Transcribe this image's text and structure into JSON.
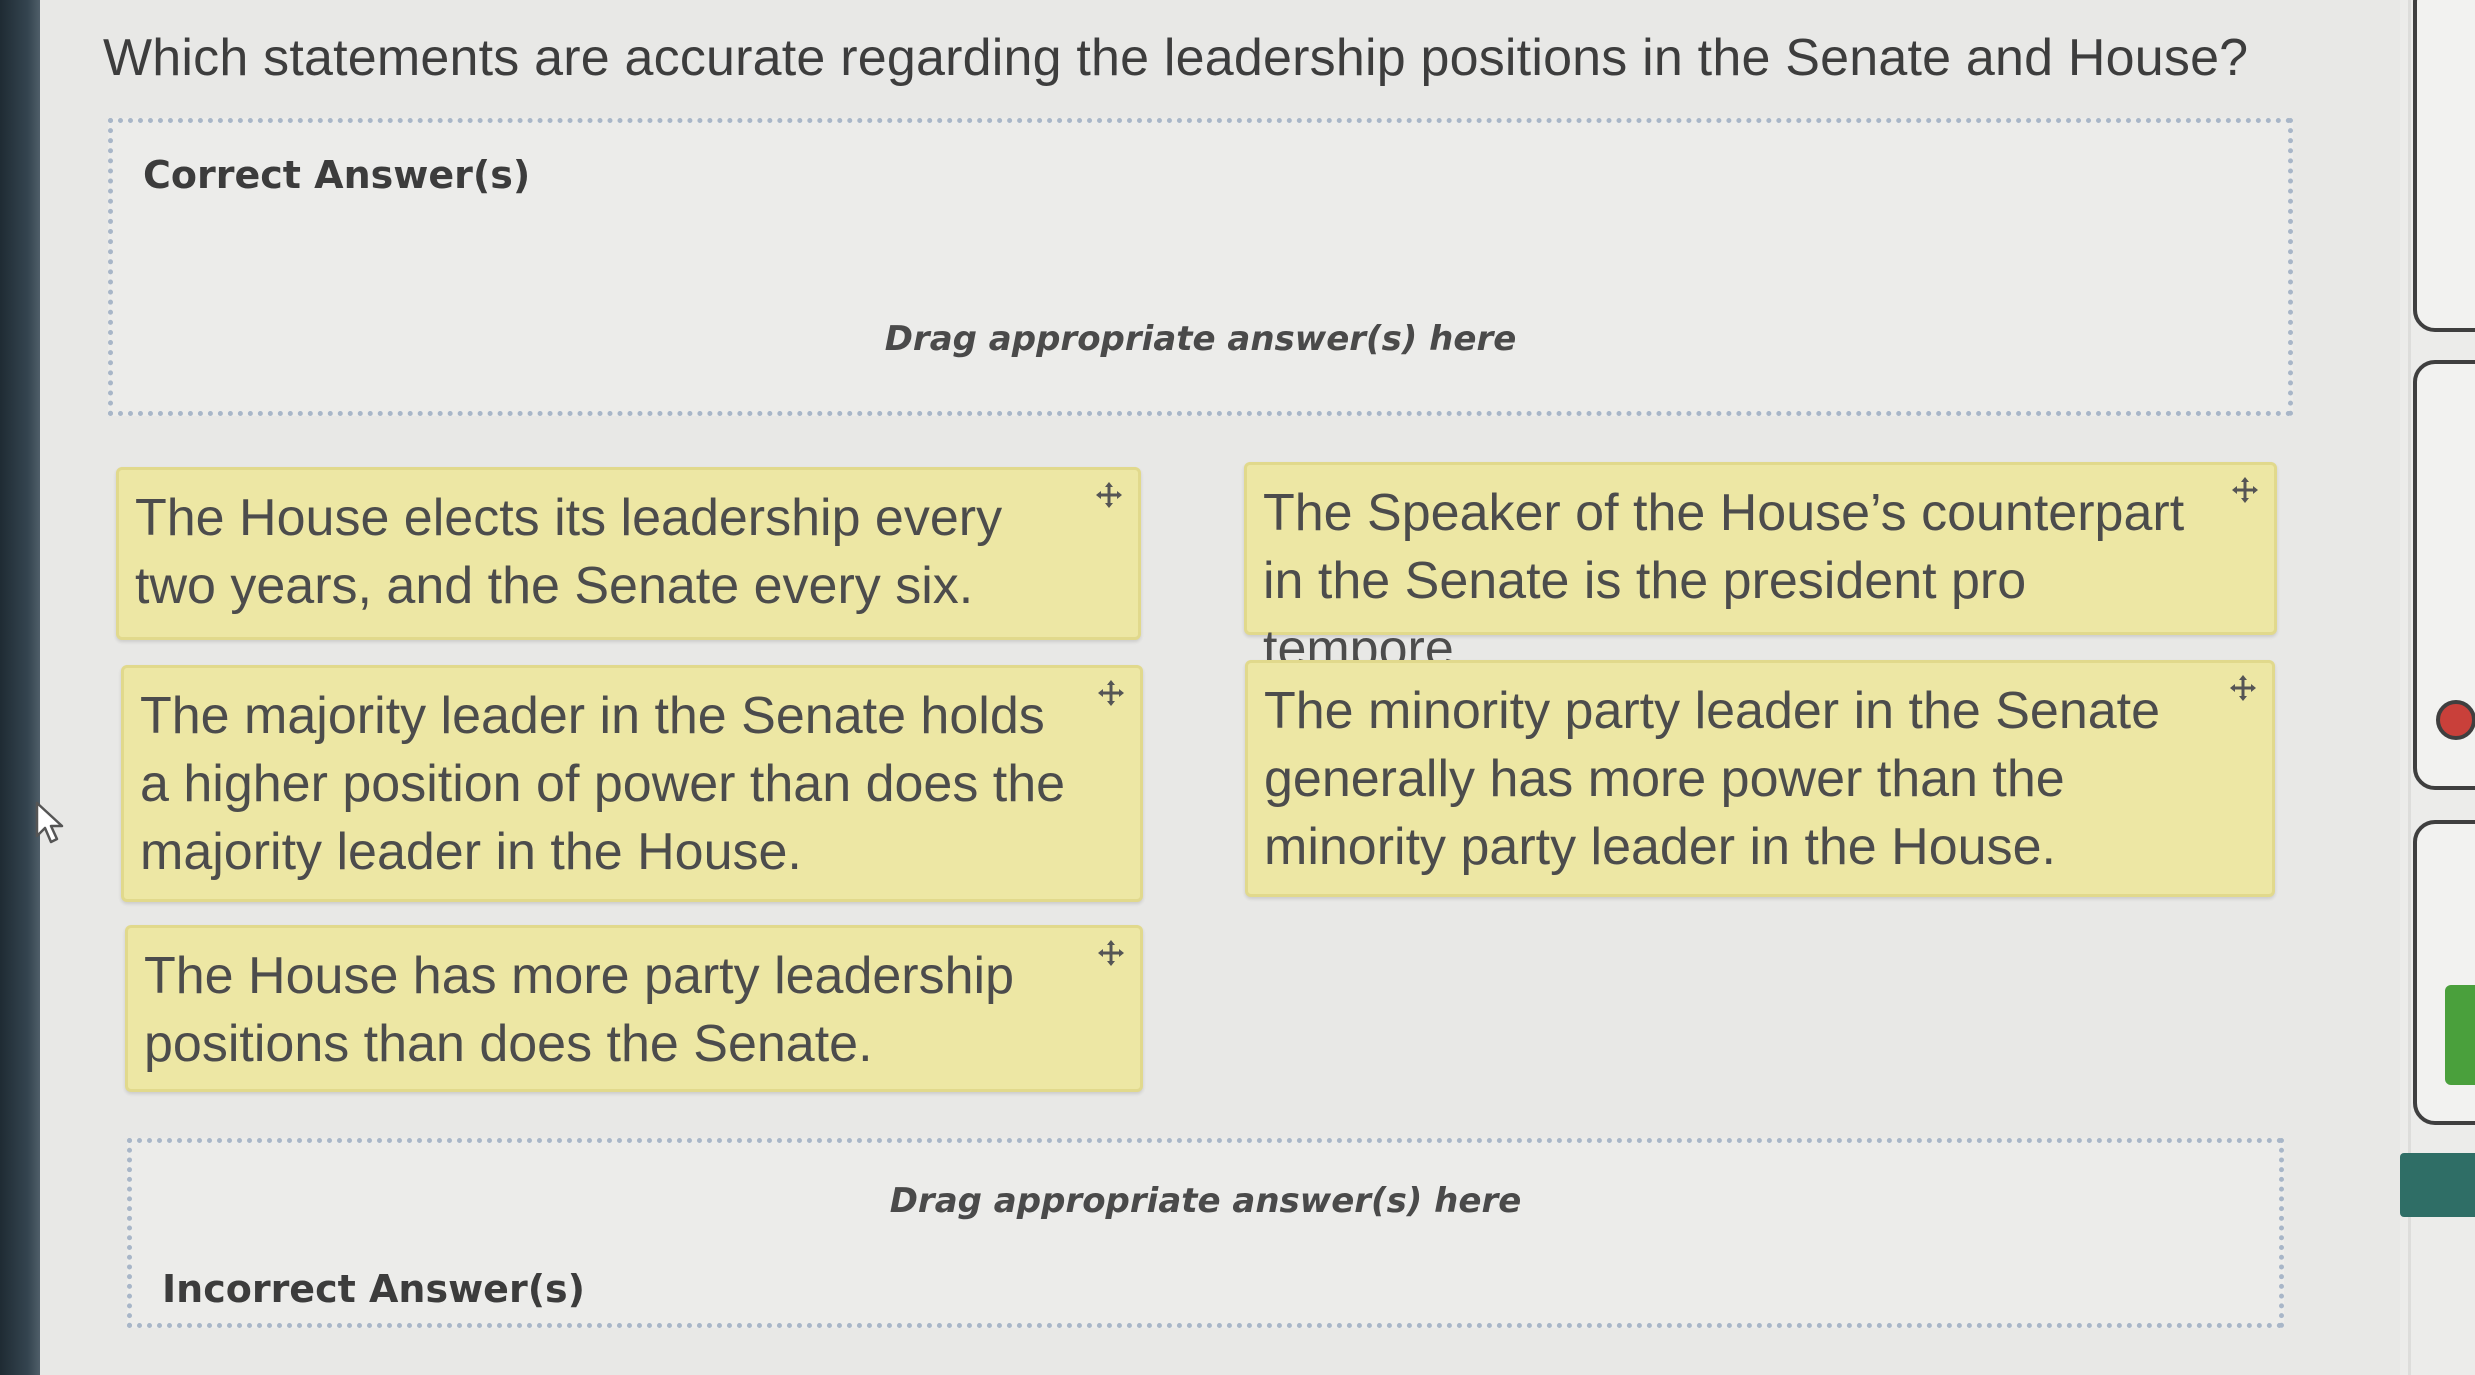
{
  "question": {
    "text": "Which statements are accurate regarding the leadership positions in the Senate and House?"
  },
  "dropzones": {
    "correct": {
      "label": "Correct Answer(s)",
      "hint": "Drag appropriate answer(s) here"
    },
    "incorrect": {
      "label": "Incorrect Answer(s)",
      "hint": "Drag appropriate answer(s) here"
    }
  },
  "answers": [
    {
      "text": "The House elects its leadership every two years, and the Senate every six."
    },
    {
      "text": "The Speaker of the House’s counterpart in the Senate is the president pro tempore."
    },
    {
      "text": "The majority leader in the Senate holds a higher position of power than does the majority leader in the House."
    },
    {
      "text": "The minority party leader in the Senate generally has more power than the minority party leader in the House."
    },
    {
      "text": "The House has more party leadership positions than does the Senate."
    }
  ],
  "colors": {
    "card_background": "#ede7a4",
    "dropzone_border": "#a8b6c8",
    "screen_background": "#e8e8e6"
  },
  "icons": {
    "card_handle": "move-icon",
    "pointer": "cursor-icon"
  }
}
